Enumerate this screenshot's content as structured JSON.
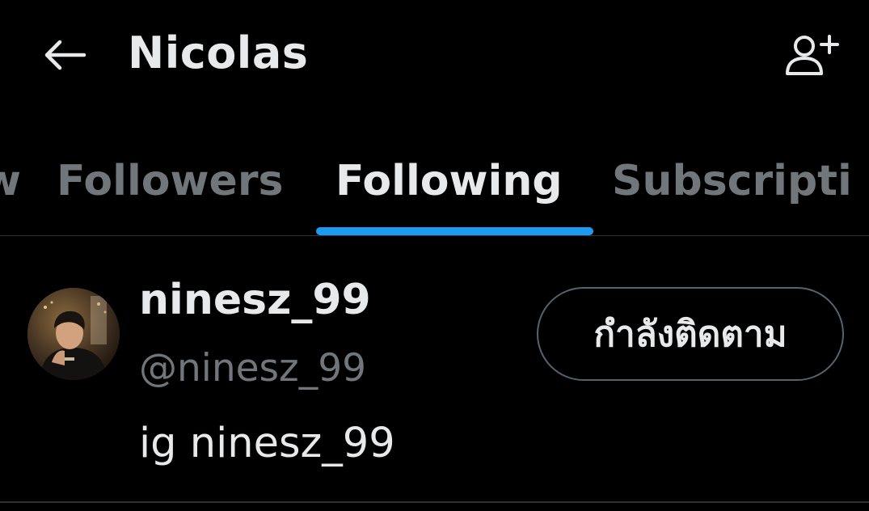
{
  "header": {
    "back_icon": "arrow-left-icon",
    "title": "Nicolas",
    "add_user_icon": "person-plus-icon"
  },
  "tabs": [
    {
      "label": "w",
      "active": false
    },
    {
      "label": "Followers",
      "active": false
    },
    {
      "label": "Following",
      "active": true
    },
    {
      "label": "Subscripti",
      "active": false
    }
  ],
  "user": {
    "display_name": "ninesz_99",
    "handle": "@ninesz_99",
    "bio": "ig ninesz_99",
    "follow_button_label": "กำลังติดตาม"
  },
  "colors": {
    "background": "#000000",
    "primary_text": "#e7e9ea",
    "secondary_text": "#71767b",
    "accent": "#1d9bf0",
    "border": "#2f3336"
  }
}
